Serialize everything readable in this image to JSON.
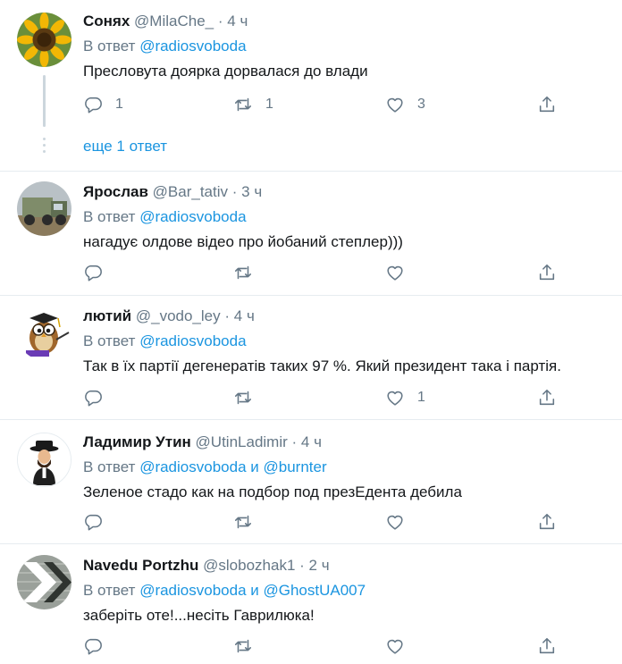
{
  "tweets": [
    {
      "name": "Сонях",
      "handle": "@MilaChe_",
      "dot": "·",
      "time": "4 ч",
      "reply_prefix": "В ответ",
      "reply_to_1": "@radiosvoboda",
      "reply_and": "",
      "reply_to_2": "",
      "text": "Пресловута доярка дорвалася до влади",
      "reply_count": "1",
      "retweet_count": "1",
      "like_count": "3",
      "avatar": "sunflower"
    },
    {
      "name": "Ярослав",
      "handle": "@Bar_tativ",
      "dot": "·",
      "time": "3 ч",
      "reply_prefix": "В ответ",
      "reply_to_1": "@radiosvoboda",
      "reply_and": "",
      "reply_to_2": "",
      "text": "нагадує олдове відео про йобаний степлер)))",
      "reply_count": "",
      "retweet_count": "",
      "like_count": "",
      "avatar": "truck"
    },
    {
      "name": "лютий",
      "handle": "@_vodo_ley",
      "dot": "·",
      "time": "4 ч",
      "reply_prefix": "В ответ",
      "reply_to_1": "@radiosvoboda",
      "reply_and": "",
      "reply_to_2": "",
      "text": "Так в їх партії дегенератів таких 97 %. Який президент така і партія.",
      "reply_count": "",
      "retweet_count": "",
      "like_count": "1",
      "avatar": "owl"
    },
    {
      "name": "Ладимир Утин",
      "handle": "@UtinLadimir",
      "dot": "·",
      "time": "4 ч",
      "reply_prefix": "В ответ",
      "reply_to_1": "@radiosvoboda",
      "reply_and": "и",
      "reply_to_2": "@burnter",
      "text": "Зеленое стадо как на подбор под презЕдента дебила",
      "reply_count": "",
      "retweet_count": "",
      "like_count": "",
      "avatar": "man-in-hat"
    },
    {
      "name": "Navedu Portzhu",
      "handle": "@slobozhak1",
      "dot": "·",
      "time": "2 ч",
      "reply_prefix": "В ответ",
      "reply_to_1": "@radiosvoboda",
      "reply_and": "и",
      "reply_to_2": "@GhostUA007",
      "text": "заберіть оте!...несіть Гаврилюка!",
      "reply_count": "",
      "retweet_count": "",
      "like_count": "",
      "avatar": "arrow-wall"
    }
  ],
  "thread": {
    "more_replies": "еще 1 ответ"
  },
  "icons": {
    "reply": "reply-icon",
    "retweet": "retweet-icon",
    "like": "like-icon",
    "share": "share-icon"
  },
  "colors": {
    "link": "#1b95e0",
    "secondary": "#657786",
    "text": "#14171a",
    "divider": "#e6ecf0"
  }
}
